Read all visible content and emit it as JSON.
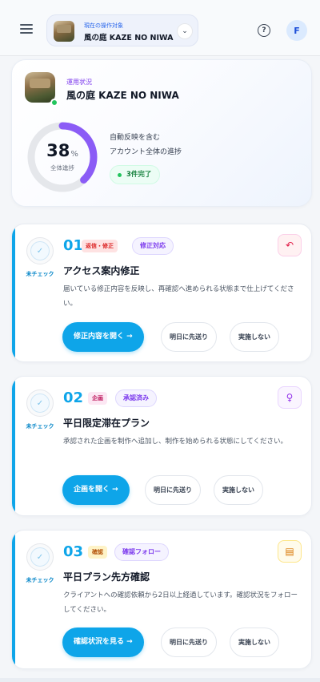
{
  "header": {
    "target_caption": "現在の操作対象",
    "target_name": "風の庭 KAZE NO NIWA",
    "chevron": "⌄",
    "help": "?",
    "avatar_letter": "F"
  },
  "status": {
    "label": "運用状況",
    "title": "風の庭 KAZE NO NIWA",
    "progress_value": "38",
    "progress_unit": "%",
    "progress_fraction": 0.38,
    "progress_caption": "全体進捗",
    "desc_line1": "自動反映を含む",
    "desc_line2": "アカウント全体の進捗",
    "done_chip": "3件完了",
    "colors": {
      "progress": "#8b5cf6",
      "track": "#e5e7eb",
      "online": "#22c55e"
    }
  },
  "tasks": [
    {
      "check_label": "未チェック",
      "num": "01",
      "type_tag": "返信・修正",
      "type_tag_colors": {
        "bg": "#fee2e2",
        "fg": "#dc2626"
      },
      "status_tag": "修正対応",
      "status_tag_colors": {
        "bg": "#f5f3ff",
        "fg": "#7c3aed",
        "border": "#ddd6fe"
      },
      "action_icon": "reply-icon",
      "action_glyph": "↶",
      "action_colors": {
        "bg": "#fff1f2",
        "fg": "#e11d48",
        "border": "#fbcfe8"
      },
      "title": "アクセス案内修正",
      "desc": "届いている修正内容を反映し、再確認へ進められる状態まで仕上げてください。",
      "primary": "修正内容を開く →",
      "postpone": "明日に先送り",
      "skip": "実施しない"
    },
    {
      "check_label": "未チェック",
      "num": "02",
      "type_tag": "企画",
      "type_tag_colors": {
        "bg": "#fce7f3",
        "fg": "#be185d"
      },
      "status_tag": "承認済み",
      "status_tag_colors": {
        "bg": "#f5f3ff",
        "fg": "#7c3aed",
        "border": "#ddd6fe"
      },
      "action_icon": "lightbulb-icon",
      "action_glyph": "♀",
      "action_colors": {
        "bg": "#faf5ff",
        "fg": "#9333ea",
        "border": "#e9d5ff"
      },
      "title": "平日限定滞在プラン",
      "desc": "承認された企画を制作へ追加し、制作を始められる状態にしてください。",
      "primary": "企画を開く →",
      "postpone": "明日に先送り",
      "skip": "実施しない"
    },
    {
      "check_label": "未チェック",
      "num": "03",
      "type_tag": "確認",
      "type_tag_colors": {
        "bg": "#fef3c7",
        "fg": "#b45309"
      },
      "status_tag": "確認フォロー",
      "status_tag_colors": {
        "bg": "#f5f3ff",
        "fg": "#7c3aed",
        "border": "#ddd6fe"
      },
      "action_icon": "clipboard-icon",
      "action_glyph": "▤",
      "action_colors": {
        "bg": "#fffbeb",
        "fg": "#d97706",
        "border": "#fde68a"
      },
      "title": "平日プラン先方確認",
      "desc": "クライアントへの確認依頼から2日以上経過しています。確認状況をフォローしてください。",
      "primary": "確認状況を見る →",
      "postpone": "明日に先送り",
      "skip": "実施しない"
    }
  ]
}
